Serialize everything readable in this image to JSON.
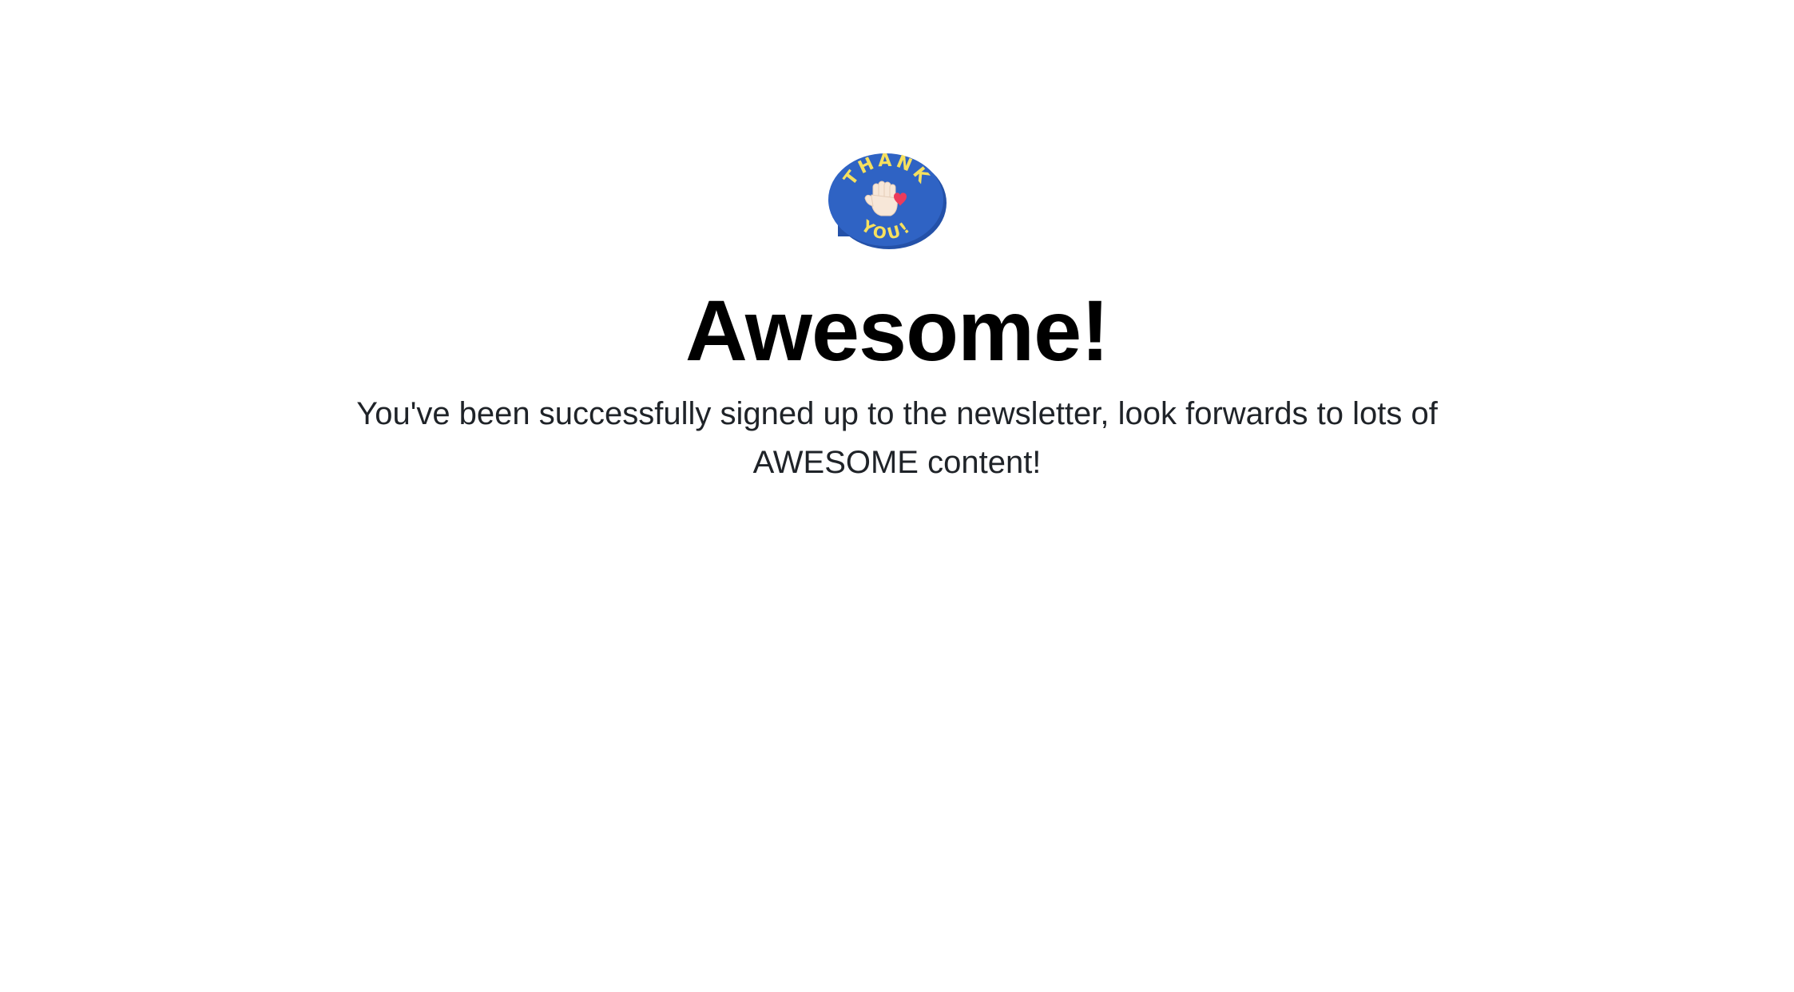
{
  "confirmation": {
    "badge": {
      "icon": "thank-you-speech-bubble-icon",
      "top_text": "THANK",
      "bottom_text": "YOU!",
      "colors": {
        "bubble": "#2f63c4",
        "bubble_shadow": "#2451a8",
        "lettering": "#f6e05e",
        "hand": "#f7e7d8",
        "heart": "#ec3b5b"
      }
    },
    "title": "Awesome!",
    "message": "You've been successfully signed up to the newsletter, look forwards to lots of AWESOME content!"
  }
}
